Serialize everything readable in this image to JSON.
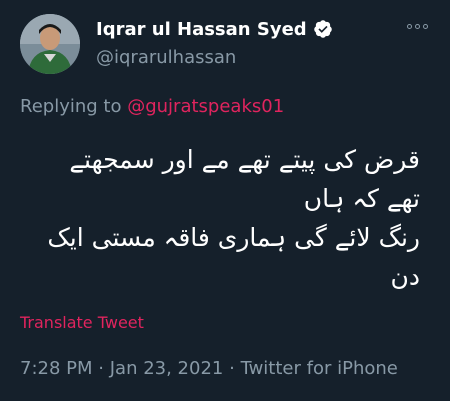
{
  "author": {
    "display_name": "Iqrar ul Hassan Syed",
    "handle": "@iqrarulhassan",
    "verified": true,
    "avatar_icon": "profile-photo"
  },
  "more_icon": "more-options-icon",
  "reply": {
    "prefix": "Replying to",
    "mention": "@gujratspeaks01"
  },
  "tweet": {
    "lines": [
      "قرض کی پیتے تھے مے اور سمجھتے",
      "تھے کہ ہاں",
      "رنگ لائے گی ہماری فاقہ مستی ایک",
      "دن"
    ]
  },
  "translate_label": "Translate Tweet",
  "meta": {
    "time": "7:28 PM",
    "date": "Jan 23, 2021",
    "source": "Twitter for iPhone",
    "separator": "·"
  },
  "colors": {
    "background": "#15202b",
    "secondary_text": "#8899a6",
    "accent": "#e0245e",
    "verified": "#ffffff"
  }
}
